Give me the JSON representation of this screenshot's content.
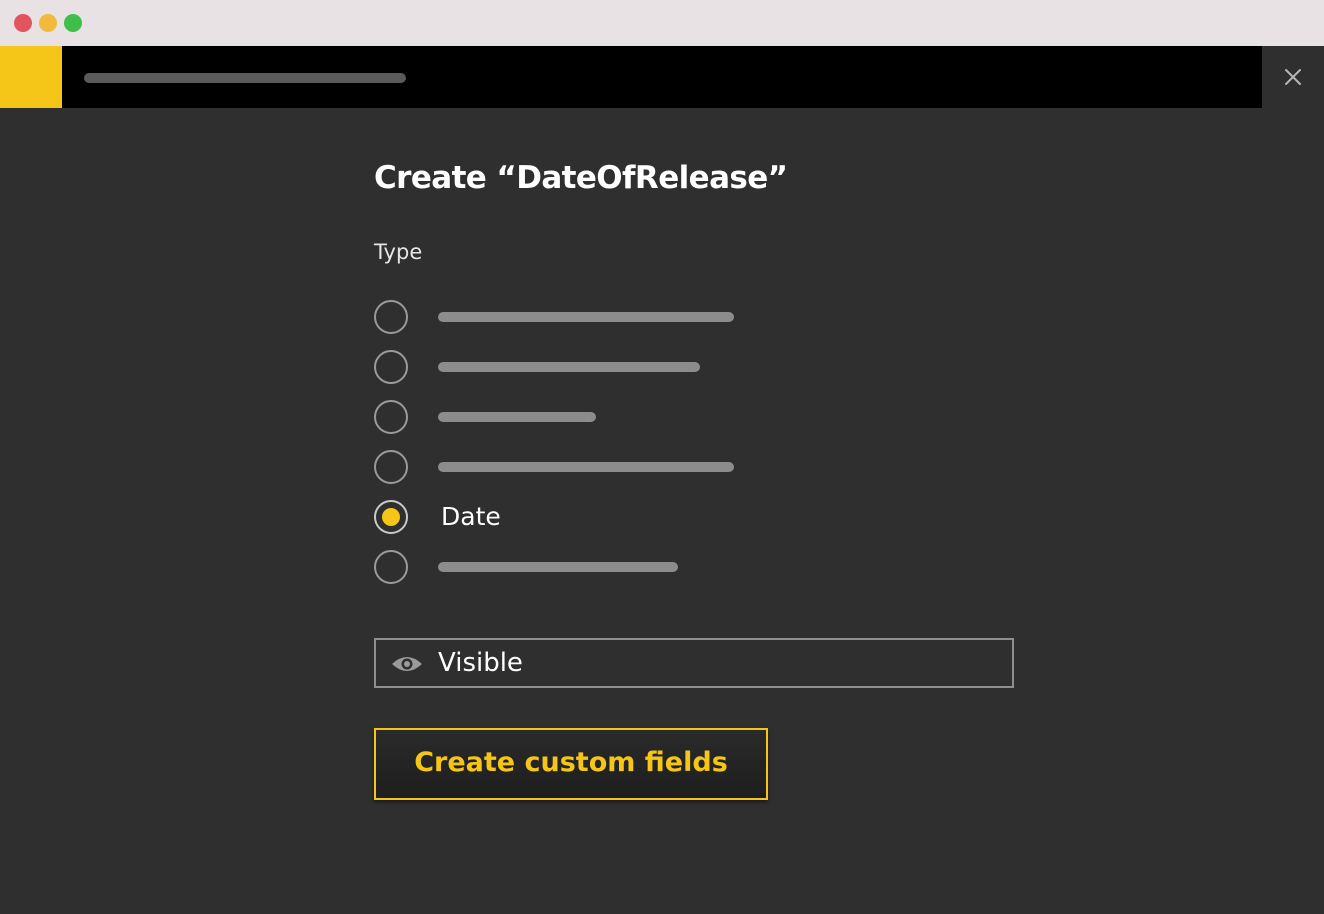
{
  "colors": {
    "accent": "#f5c518",
    "traffic_red": "#e0555f",
    "traffic_yellow": "#f3b93a",
    "traffic_green": "#3fbf4a"
  },
  "header": {
    "close_icon": "close-icon"
  },
  "form": {
    "title": "Create “DateOfRelease”",
    "type_label": "Type",
    "options": [
      {
        "label": "",
        "selected": false
      },
      {
        "label": "",
        "selected": false
      },
      {
        "label": "",
        "selected": false
      },
      {
        "label": "",
        "selected": false
      },
      {
        "label": "Date",
        "selected": true
      },
      {
        "label": "",
        "selected": false
      }
    ],
    "visibility": {
      "icon": "eye-icon",
      "label": "Visible"
    },
    "submit_label": "Create custom fields"
  }
}
